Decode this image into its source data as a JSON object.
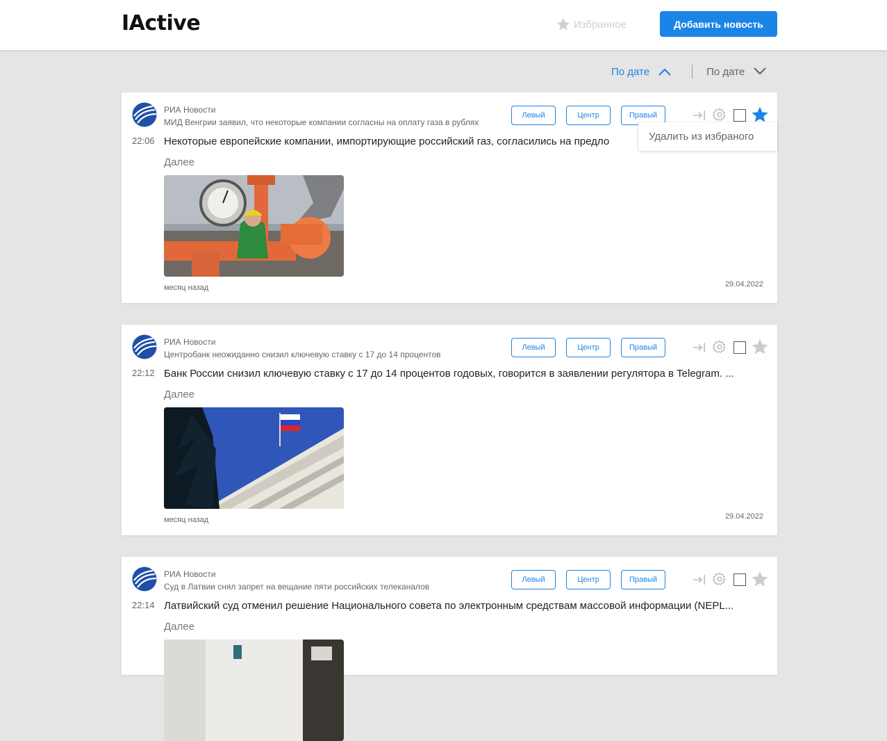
{
  "header": {
    "logo": "IActive",
    "favorites_label": "Избранное",
    "add_button_label": "Добавить новость"
  },
  "sort": {
    "primary_label": "По дате",
    "primary_direction": "up",
    "secondary_label": "По дате",
    "secondary_direction": "down"
  },
  "tags": {
    "left": "Левый",
    "center": "Центр",
    "right": "Правый"
  },
  "tooltip": "Удалить из избраного",
  "articles": [
    {
      "source": "РИА Новости",
      "subtitle": "МИД Венгрии заявил, что некоторые компании согласны на оплату газа в рублях",
      "time": "22:06",
      "headline": "Некоторые европейские компании, импортирующие российский газ, согласились на предло",
      "more": "Далее",
      "ago": "месяц назад",
      "date": "29.04.2022",
      "favorited": true,
      "image": "gas-pipeline-worker"
    },
    {
      "source": "РИА Новости",
      "subtitle": "Центробанк неожиданно снизил ключевую ставку с 17 до 14 процентов",
      "time": "22:12",
      "headline": "Банк России снизил ключевую ставку с 17 до 14 процентов годовых, говорится в заявлении регулятора в Telegram. ...",
      "more": "Далее",
      "ago": "месяц назад",
      "date": "29.04.2022",
      "favorited": false,
      "image": "bank-of-russia-building"
    },
    {
      "source": "РИА Новости",
      "subtitle": "Суд в Латвии снял запрет на вещание пяти российских телеканалов",
      "time": "22:14",
      "headline": "Латвийский суд отменил решение Национального совета по электронным средствам массовой информации (NEPL...",
      "more": "Далее",
      "ago": "",
      "date": "",
      "favorited": false,
      "image": "courtroom"
    }
  ],
  "colors": {
    "accent": "#1b84e7",
    "background": "#e5e5e5",
    "card": "#ffffff",
    "muted_icon": "#cccccc"
  }
}
